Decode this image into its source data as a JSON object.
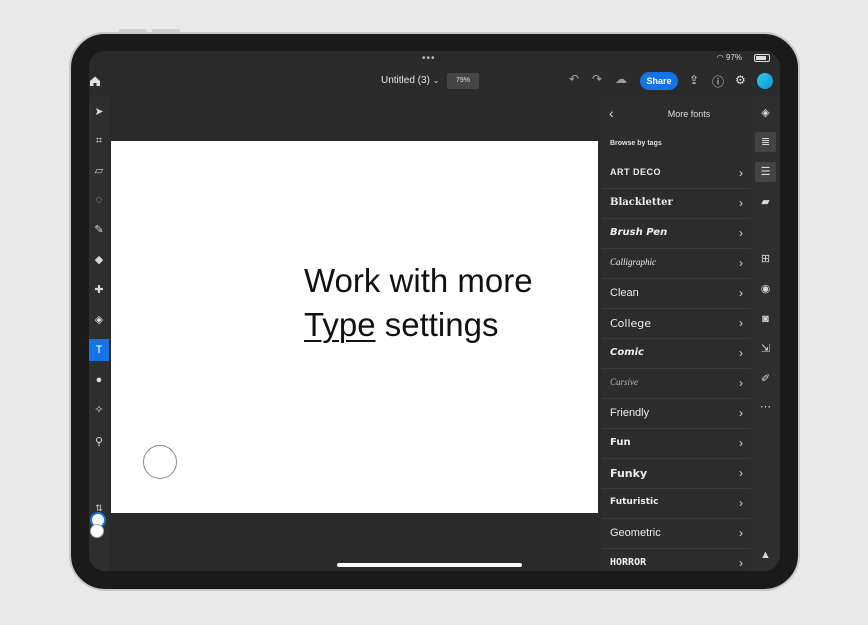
{
  "status": {
    "battery": "97%"
  },
  "header": {
    "title": "Untitled (3)",
    "zoom": "79%",
    "share_label": "Share"
  },
  "canvas": {
    "line1": "Work with more",
    "line2_underlined": "Type",
    "line2_rest": " settings"
  },
  "panel": {
    "title": "More fonts",
    "browse_label": "Browse by tags",
    "items": [
      {
        "label": "ART DECO"
      },
      {
        "label": "Blackletter"
      },
      {
        "label": "Brush Pen"
      },
      {
        "label": "Calligraphic"
      },
      {
        "label": "Clean"
      },
      {
        "label": "College"
      },
      {
        "label": "Comic"
      },
      {
        "label": "Cursive"
      },
      {
        "label": "Friendly"
      },
      {
        "label": "Fun"
      },
      {
        "label": "Funky"
      },
      {
        "label": "Futuristic"
      },
      {
        "label": "Geometric"
      },
      {
        "label": "HORROR"
      }
    ]
  },
  "colors": {
    "accent": "#1473e6",
    "avatar": "#25d0f0"
  }
}
